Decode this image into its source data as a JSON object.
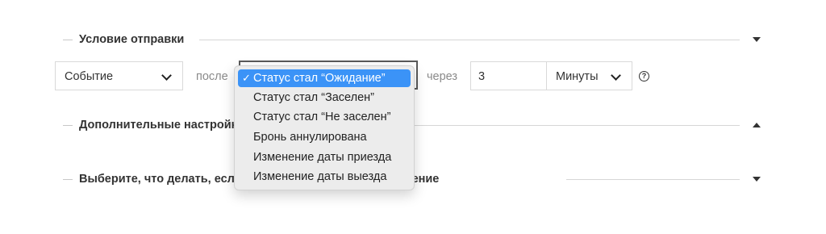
{
  "sections": {
    "send_condition": {
      "title": "Условие отправки"
    },
    "additional": {
      "title": "Дополнительные настройки"
    },
    "no_response": {
      "title": "Выберите, что делать, если гость не реагирует на сообщение"
    }
  },
  "condition": {
    "trigger_type": "Событие",
    "after_label": "после",
    "delay_label": "через",
    "delay_value": "3",
    "delay_unit": "Минуты",
    "help_glyph": "?"
  },
  "event_dropdown": {
    "check_glyph": "✓",
    "selected_index": 0,
    "options": [
      "Статус стал “Ожидание”",
      "Статус стал “Заселен”",
      "Статус стал “Не заселен”",
      "Бронь аннулирована",
      "Изменение даты приезда",
      "Изменение даты выезда"
    ]
  },
  "colors": {
    "selection": "#3b93f7",
    "menu_background": "#ececec"
  }
}
